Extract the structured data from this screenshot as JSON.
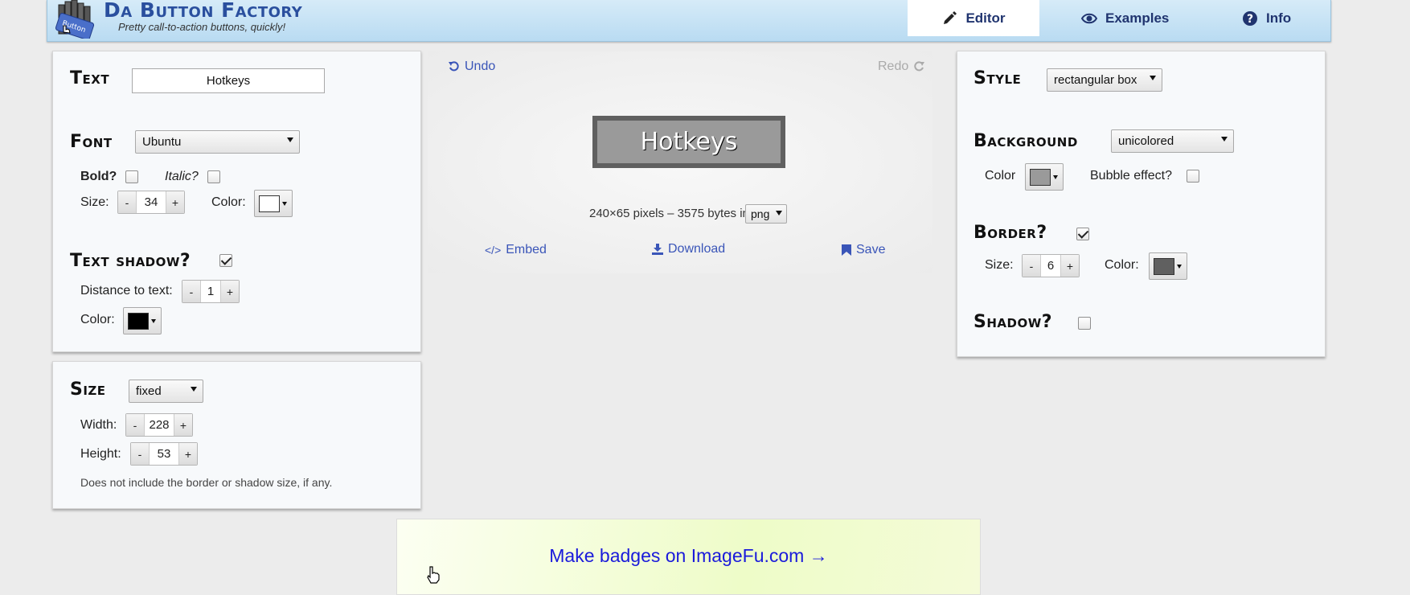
{
  "header": {
    "brand_title": "Da Button Factory",
    "brand_subtitle": "Pretty call-to-action buttons, quickly!",
    "logo_text": "Button",
    "tabs": [
      {
        "label": "Editor",
        "icon": "pencil-icon",
        "active": true
      },
      {
        "label": "Examples",
        "icon": "eye-icon",
        "active": false
      },
      {
        "label": "Info",
        "icon": "question-circle-icon",
        "active": false
      }
    ]
  },
  "text_panel": {
    "title": "Text",
    "text_value": "Hotkeys",
    "font_title": "Font",
    "font_value": "Ubuntu",
    "bold_label": "Bold?",
    "bold_checked": false,
    "italic_label": "Italic?",
    "italic_checked": false,
    "size_label": "Size:",
    "size_value": "34",
    "color_label": "Color:",
    "text_color": "#ffffff",
    "shadow_title": "Text shadow?",
    "shadow_checked": true,
    "distance_label": "Distance to text:",
    "distance_value": "1",
    "shadow_color_label": "Color:",
    "shadow_color": "#000000"
  },
  "size_panel": {
    "title": "Size",
    "mode_value": "fixed",
    "width_label": "Width:",
    "width_value": "228",
    "height_label": "Height:",
    "height_value": "53",
    "note": "Does not include the border or shadow size, if any."
  },
  "center": {
    "undo_label": "Undo",
    "redo_label": "Redo",
    "preview_text": "Hotkeys",
    "info_text": "240×65 pixels – 3575 bytes in",
    "format_value": "png",
    "embed_label": "Embed",
    "download_label": "Download",
    "save_label": "Save"
  },
  "style_panel": {
    "style_title": "Style",
    "style_value": "rectangular box",
    "background_title": "Background",
    "background_value": "unicolored",
    "bg_color_label": "Color",
    "bg_color": "#9a9a9a",
    "bubble_label": "Bubble effect?",
    "bubble_checked": false,
    "border_title": "Border?",
    "border_checked": true,
    "border_size_label": "Size:",
    "border_size_value": "6",
    "border_color_label": "Color:",
    "border_color": "#606060",
    "shadow_title": "Shadow?",
    "shadow_checked": false
  },
  "ad": {
    "link_text": "Make badges on ImageFu.com →"
  },
  "colors": {
    "accent": "#3a55b8",
    "nav_text": "#20346f",
    "brand": "#2a4f9e",
    "ad_link": "#1a1adb"
  }
}
